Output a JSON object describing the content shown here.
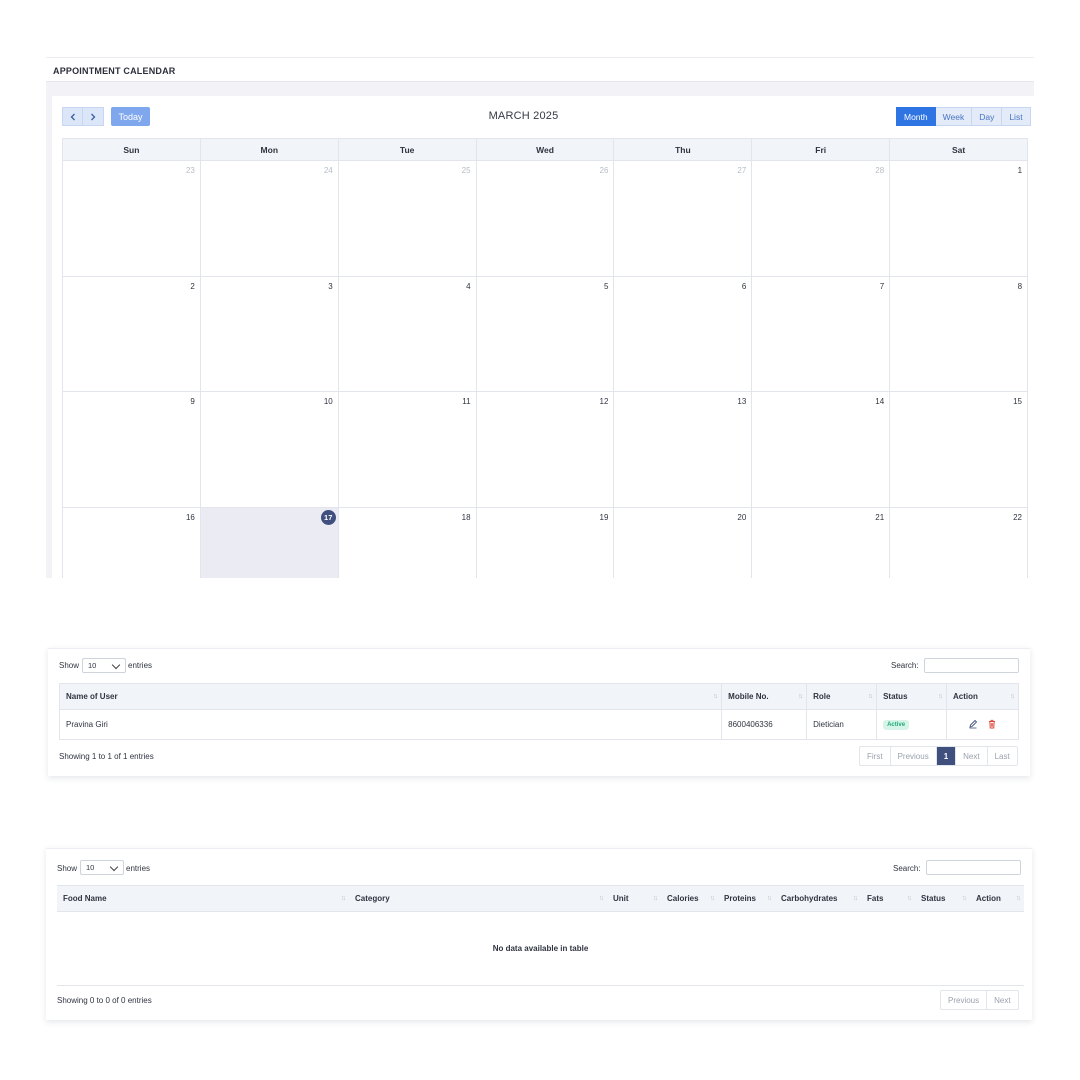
{
  "calendar": {
    "title": "APPOINTMENT CALENDAR",
    "prev_icon": "chevron-left-icon",
    "next_icon": "chevron-right-icon",
    "today_label": "Today",
    "month_label": "MARCH 2025",
    "views": [
      "Month",
      "Week",
      "Day",
      "List"
    ],
    "active_view": "Month",
    "weekdays": [
      "Sun",
      "Mon",
      "Tue",
      "Wed",
      "Thu",
      "Fri",
      "Sat"
    ],
    "weeks": [
      [
        {
          "d": "23",
          "other": true
        },
        {
          "d": "24",
          "other": true
        },
        {
          "d": "25",
          "other": true
        },
        {
          "d": "26",
          "other": true
        },
        {
          "d": "27",
          "other": true
        },
        {
          "d": "28",
          "other": true
        },
        {
          "d": "1"
        }
      ],
      [
        {
          "d": "2"
        },
        {
          "d": "3"
        },
        {
          "d": "4"
        },
        {
          "d": "5"
        },
        {
          "d": "6"
        },
        {
          "d": "7"
        },
        {
          "d": "8"
        }
      ],
      [
        {
          "d": "9"
        },
        {
          "d": "10"
        },
        {
          "d": "11"
        },
        {
          "d": "12"
        },
        {
          "d": "13"
        },
        {
          "d": "14"
        },
        {
          "d": "15"
        }
      ],
      [
        {
          "d": "16"
        },
        {
          "d": "17",
          "today": true
        },
        {
          "d": "18"
        },
        {
          "d": "19"
        },
        {
          "d": "20"
        },
        {
          "d": "21"
        },
        {
          "d": "22"
        }
      ]
    ]
  },
  "users_table": {
    "show_label": "Show",
    "length_value": "10",
    "entries_label": "entries",
    "search_label": "Search:",
    "columns": [
      "Name of User",
      "Mobile No.",
      "Role",
      "Status",
      "Action"
    ],
    "rows": [
      {
        "name": "Pravina Giri",
        "mobile": "8600406336",
        "role": "Dietician",
        "status": "Active"
      }
    ],
    "action_icons": [
      "edit-icon",
      "trash-icon"
    ],
    "info": "Showing 1 to 1 of 1 entries",
    "pager": [
      "First",
      "Previous",
      "1",
      "Next",
      "Last"
    ],
    "current_page": "1"
  },
  "food_table": {
    "show_label": "Show",
    "length_value": "10",
    "entries_label": "entries",
    "search_label": "Search:",
    "columns": [
      "Food Name",
      "Category",
      "Unit",
      "Calories",
      "Proteins",
      "Carbohydrates",
      "Fats",
      "Status",
      "Action"
    ],
    "empty_message": "No data available in table",
    "info": "Showing 0 to 0 of 0 entries",
    "pager": [
      "Previous",
      "Next"
    ]
  },
  "colors": {
    "primary": "#2f74e3",
    "today_badge": "#3f4f7e",
    "active_badge": "#1eaa75",
    "delete": "#e0453a"
  }
}
